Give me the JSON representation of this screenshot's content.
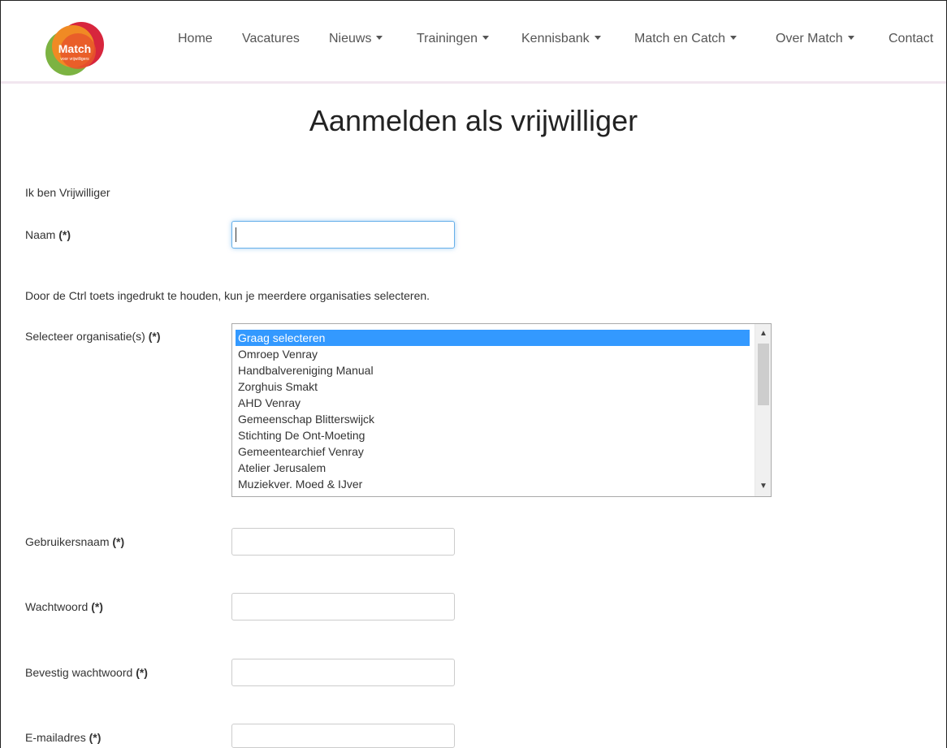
{
  "brand": {
    "logo_text": "Match",
    "logo_subtext": "voor vrijwilligers"
  },
  "nav": {
    "items": [
      {
        "label": "Home",
        "dropdown": false
      },
      {
        "label": "Vacatures",
        "dropdown": false
      },
      {
        "label": "Nieuws",
        "dropdown": true
      },
      {
        "label": "Trainingen",
        "dropdown": true
      },
      {
        "label": "Kennisbank",
        "dropdown": true
      },
      {
        "label": "Match en Catch",
        "dropdown": true
      },
      {
        "label": "Over Match",
        "dropdown": true
      },
      {
        "label": "Contact",
        "dropdown": false
      }
    ]
  },
  "page": {
    "title": "Aanmelden als vrijwilliger",
    "role_text": "Ik ben Vrijwilliger",
    "help_text": "Door de Ctrl toets ingedrukt te houden, kun je meerdere organisaties selecteren.",
    "required_marker": "(*)"
  },
  "form": {
    "naam_label": "Naam",
    "naam_value": "",
    "org_label": "Selecteer organisatie(s)",
    "organisations": [
      "Graag selecteren",
      "Omroep Venray",
      "Handbalvereniging Manual",
      "Zorghuis Smakt",
      "AHD Venray",
      "Gemeenschap Blitterswijck",
      "Stichting De Ont-Moeting",
      "Gemeentearchief Venray",
      "Atelier Jerusalem",
      "Muziekver. Moed & IJver"
    ],
    "selected_organisation": "Graag selecteren",
    "gebruikersnaam_label": "Gebruikersnaam",
    "gebruikersnaam_value": "",
    "wachtwoord_label": "Wachtwoord",
    "wachtwoord_value": "",
    "bevestig_label": "Bevestig wachtwoord",
    "bevestig_value": "",
    "email_label": "E-mailadres",
    "email_value": ""
  },
  "colors": {
    "selection": "#3399ff",
    "focus_ring": "#66afe9",
    "logo_orange": "#f08a24",
    "logo_red": "#d7263d",
    "logo_green": "#7cb342"
  }
}
